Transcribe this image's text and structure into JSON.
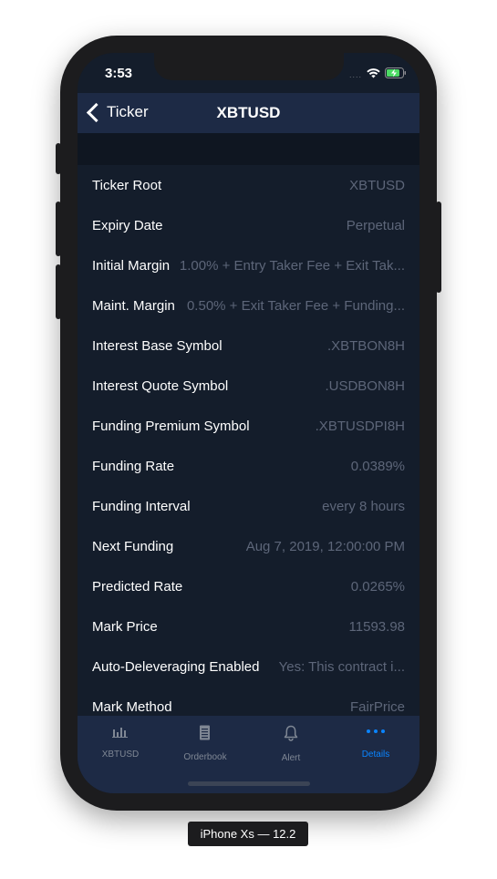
{
  "status": {
    "time": "3:53",
    "signal": "....",
    "wifi_icon": "wifi-icon",
    "battery_icon": "battery-charging-icon"
  },
  "navbar": {
    "back_label": "Ticker",
    "title": "XBTUSD"
  },
  "rows": [
    {
      "label": "Ticker Root",
      "value": "XBTUSD"
    },
    {
      "label": "Expiry Date",
      "value": "Perpetual"
    },
    {
      "label": "Initial Margin",
      "value": "1.00% + Entry Taker Fee + Exit Tak..."
    },
    {
      "label": "Maint. Margin",
      "value": "0.50% + Exit Taker Fee + Funding..."
    },
    {
      "label": "Interest Base Symbol",
      "value": ".XBTBON8H"
    },
    {
      "label": "Interest Quote Symbol",
      "value": ".USDBON8H"
    },
    {
      "label": "Funding Premium Symbol",
      "value": ".XBTUSDPI8H"
    },
    {
      "label": "Funding Rate",
      "value": "0.0389%"
    },
    {
      "label": "Funding Interval",
      "value": "every 8 hours"
    },
    {
      "label": "Next Funding",
      "value": "Aug 7, 2019, 12:00:00 PM"
    },
    {
      "label": "Predicted Rate",
      "value": "0.0265%"
    },
    {
      "label": "Mark Price",
      "value": "11593.98"
    },
    {
      "label": "Auto-Deleveraging Enabled",
      "value": "Yes: This contract i..."
    },
    {
      "label": "Mark Method",
      "value": "FairPrice"
    }
  ],
  "tabs": [
    {
      "label": "XBTUSD",
      "icon": "bar-chart-icon",
      "active": false
    },
    {
      "label": "Orderbook",
      "icon": "document-icon",
      "active": false
    },
    {
      "label": "Alert",
      "icon": "bell-icon",
      "active": false
    },
    {
      "label": "Details",
      "icon": "more-dots-icon",
      "active": true
    }
  ],
  "device_label": "iPhone Xs — 12.2",
  "colors": {
    "accent": "#0a84ff",
    "navbar": "#1d2a45",
    "background": "#141d2b"
  }
}
